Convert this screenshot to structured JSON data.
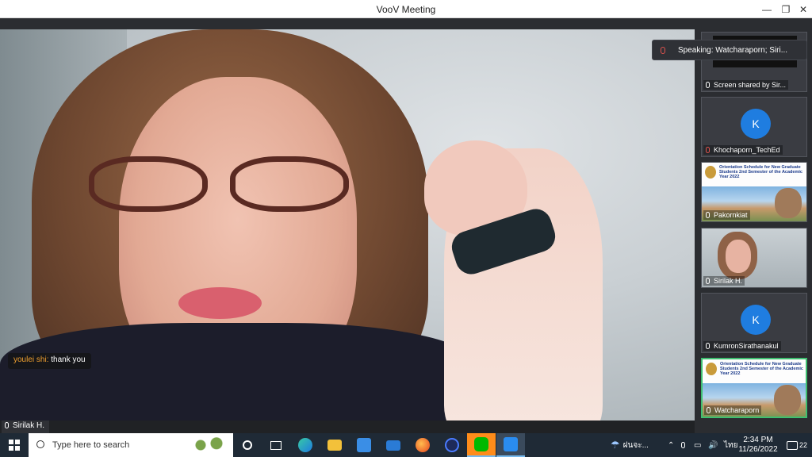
{
  "window": {
    "title": "VooV Meeting"
  },
  "main_video": {
    "participant": "Sirilak H.",
    "chat": {
      "sender": "youlei shi:",
      "message": " thank you"
    }
  },
  "speaking": {
    "text": "Speaking: Watcharaporn; Siri..."
  },
  "participants": [
    {
      "name": "Screen shared by Sir...",
      "kind": "screen",
      "mic": "on"
    },
    {
      "name": "Khochaporn_TechEd",
      "kind": "avatar",
      "initial": "K",
      "mic": "muted"
    },
    {
      "name": "Pakornkiat",
      "kind": "slide",
      "mic": "on"
    },
    {
      "name": "Sirilak H.",
      "kind": "video",
      "mic": "on"
    },
    {
      "name": "KumronSirathanakul",
      "kind": "avatar",
      "initial": "K",
      "mic": "on"
    },
    {
      "name": "Watcharaporn",
      "kind": "slide",
      "mic": "on",
      "active": true
    }
  ],
  "slide": {
    "title": "Orientation Schedule for New Graduate Students 2nd Semester of the Academic Year 2022"
  },
  "taskbar": {
    "search_placeholder": "Type here to search",
    "weather": "ฝนจะ...",
    "language": "ไทย",
    "time": "2:34 PM",
    "date": "11/26/2022",
    "notification_count": "22"
  },
  "colors": {
    "accent": "#1f7de0",
    "active_border": "#3ebf70",
    "chat_sender": "#f0a030"
  }
}
